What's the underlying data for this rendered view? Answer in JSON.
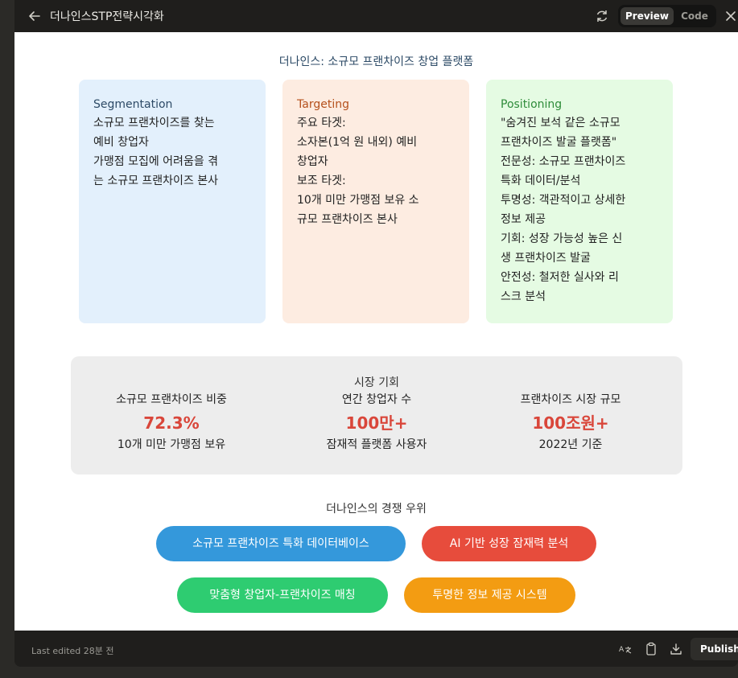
{
  "window": {
    "title": "더나인스STP전략시각화",
    "toggle": {
      "preview": "Preview",
      "code": "Code"
    },
    "last_edited": "Last edited 28분 전",
    "publish": "Publish"
  },
  "artifact": {
    "heading": "더나인스: 소규모 프랜차이즈 창업 플랫폼",
    "cards": [
      {
        "title": "Segmentation",
        "lines": [
          "소규모 프랜차이즈를 찾는",
          "예비 창업자",
          "가맹점 모집에 어려움을 겪",
          "는 소규모 프랜차이즈 본사"
        ]
      },
      {
        "title": "Targeting",
        "lines": [
          "주요 타겟:",
          "소자본(1억 원 내외) 예비",
          "창업자",
          "보조 타겟:",
          "10개 미만 가맹점 보유 소",
          "규모 프랜차이즈 본사"
        ]
      },
      {
        "title": "Positioning",
        "lines": [
          "\"숨겨진 보석 같은 소규모",
          "프랜차이즈 발굴 플랫폼\"",
          "전문성: 소규모 프랜차이즈",
          "특화 데이터/분석",
          "투명성: 객관적이고 상세한",
          "정보 제공",
          "기회: 성장 가능성 높은 신",
          "생 프랜차이즈 발굴",
          "안전성: 철저한 실사와 리",
          "스크 분석"
        ]
      }
    ],
    "market": {
      "title": "시장 기회",
      "stats": [
        {
          "label": "소규모 프랜차이즈 비중",
          "value": "72.3%",
          "note": "10개 미만 가맹점 보유"
        },
        {
          "label": "연간 창업자 수",
          "value": "100만+",
          "note": "잠재적 플랫폼 사용자"
        },
        {
          "label": "프랜차이즈 시장 규모",
          "value": "100조원+",
          "note": "2022년 기준"
        }
      ]
    },
    "advantages": {
      "title": "더나인스의 경쟁 우위",
      "items": [
        {
          "label": "소규모 프랜차이즈 특화 데이터베이스",
          "color": "#3498db"
        },
        {
          "label": "AI 기반 성장 잠재력 분석",
          "color": "#e74c3c"
        },
        {
          "label": "맞춤형 창업자-프랜차이즈 매칭",
          "color": "#2ecc71"
        },
        {
          "label": "투명한 정보 제공 시스템",
          "color": "#f39c12"
        }
      ]
    }
  },
  "colors": {
    "segmentation_bg": "#e3f0fc",
    "targeting_bg": "#fdece1",
    "positioning_bg": "#e5fbe3",
    "stat_value": "#d9463a"
  }
}
